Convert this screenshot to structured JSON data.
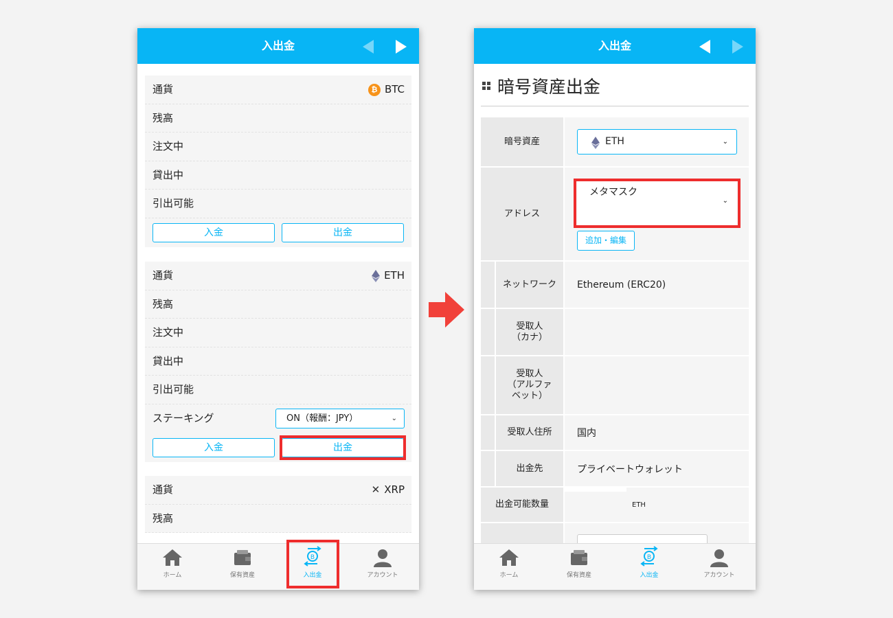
{
  "colors": {
    "accent": "#08b5f5",
    "highlight": "#ee2d2d",
    "btc": "#f7931a",
    "arrow": "#f1413a"
  },
  "left": {
    "header_title": "入出金",
    "cards": [
      {
        "currency_label": "通貨",
        "currency": "BTC",
        "currency_icon": "bitcoin-icon",
        "rows": [
          "残高",
          "注文中",
          "貸出中",
          "引出可能"
        ],
        "deposit": "入金",
        "withdraw": "出金"
      },
      {
        "currency_label": "通貨",
        "currency": "ETH",
        "currency_icon": "ethereum-icon",
        "rows": [
          "残高",
          "注文中",
          "貸出中",
          "引出可能"
        ],
        "staking_label": "ステーキング",
        "staking_value": "ON（報酬：JPY）",
        "deposit": "入金",
        "withdraw": "出金"
      },
      {
        "currency_label": "通貨",
        "currency": "XRP",
        "currency_icon": "xrp-icon",
        "rows": [
          "残高"
        ]
      }
    ]
  },
  "nav": [
    {
      "label": "ホーム",
      "icon": "home-icon"
    },
    {
      "label": "保有資産",
      "icon": "wallet-icon"
    },
    {
      "label": "入出金",
      "icon": "deposit-withdraw-icon"
    },
    {
      "label": "アカウント",
      "icon": "account-icon"
    }
  ],
  "right": {
    "header_title": "入出金",
    "page_title": "暗号資産出金",
    "fields": {
      "asset_label": "暗号資産",
      "asset_value": "ETH",
      "address_label": "アドレス",
      "address_value": "メタマスク",
      "add_edit": "追加・編集",
      "network_label": "ネットワーク",
      "network_value": "Ethereum (ERC20)",
      "recipient_kana_label": "受取人\n（カナ）",
      "recipient_alpha_label": "受取人\n（アルファベット）",
      "recipient_address_label": "受取人住所",
      "recipient_address_value": "国内",
      "destination_label": "出金先",
      "destination_value": "プライベートウォレット",
      "available_label": "出金可能数量",
      "available_unit": "ETH"
    }
  }
}
